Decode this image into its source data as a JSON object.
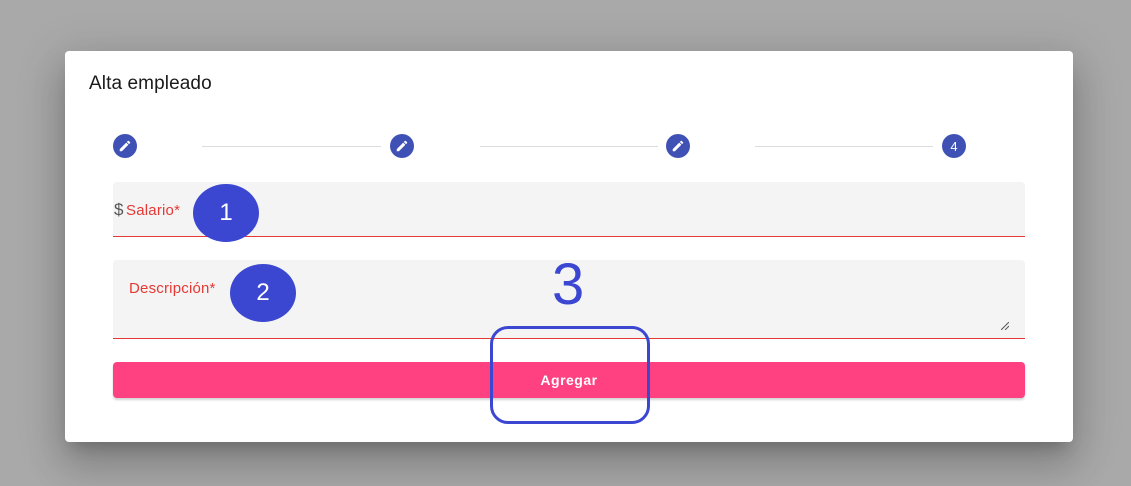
{
  "dialog": {
    "title": "Alta empleado"
  },
  "stepper": {
    "steps": [
      {
        "state": "edit",
        "icon": "pencil-icon"
      },
      {
        "state": "edit",
        "icon": "pencil-icon"
      },
      {
        "state": "edit",
        "icon": "pencil-icon"
      },
      {
        "state": "number",
        "label": "4"
      }
    ],
    "color": "#3f51b5"
  },
  "form": {
    "salary": {
      "prefix": "$",
      "label": "Salario*"
    },
    "description": {
      "label": "Descripción*"
    },
    "error_color": "#e53935"
  },
  "actions": {
    "submit_label": "Agregar",
    "submit_color": "#ff4081"
  },
  "annotations": {
    "badge1": "1",
    "badge2": "2",
    "label3": "3",
    "color": "#3b47d1"
  }
}
